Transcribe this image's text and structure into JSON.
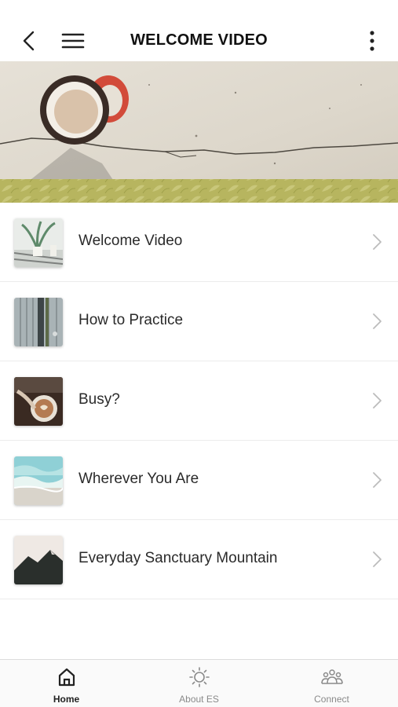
{
  "header": {
    "title": "WELCOME VIDEO",
    "back_icon": "chevron-left-icon",
    "menu_icon": "hamburger-menu-icon",
    "more_icon": "vertical-dots-icon"
  },
  "hero": {
    "image": "coffee-cup-on-concrete"
  },
  "list": {
    "items": [
      {
        "label": "Welcome Video",
        "thumb": "plants-on-table"
      },
      {
        "label": "How to Practice",
        "thumb": "wooden-door"
      },
      {
        "label": "Busy?",
        "thumb": "coffee-latte-art"
      },
      {
        "label": "Wherever You Are",
        "thumb": "ocean-waves"
      },
      {
        "label": "Everyday Sanctuary Mountain",
        "thumb": "dark-mountain"
      }
    ]
  },
  "tabbar": {
    "tabs": [
      {
        "label": "Home",
        "icon": "home-icon",
        "active": true
      },
      {
        "label": "About ES",
        "icon": "sun-icon",
        "active": false
      },
      {
        "label": "Connect",
        "icon": "people-icon",
        "active": false
      }
    ]
  }
}
